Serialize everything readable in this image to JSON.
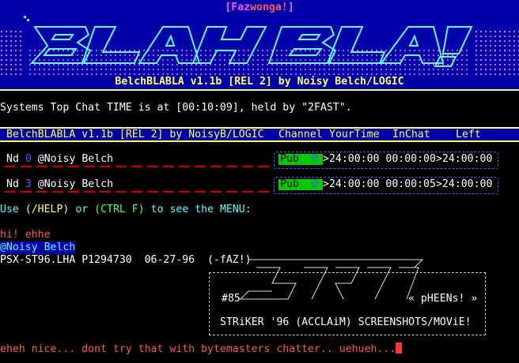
{
  "header": {
    "group_tag_prefix": "[Faz",
    "group_tag_accent": "wonga!",
    "group_tag_suffix": "]",
    "logo_text": "BLAH BLAH!",
    "subtitle": "BelchBLABLA v1.1b [REL 2] by Noisy Belch/LOGIC"
  },
  "top_chat_message": "Systems Top Chat TIME is at [00:10:09], held by \"2FAST\".",
  "status_bar": {
    "program": "BelchBLABLA v1.1b [REL 2] by NoisyB/LOGIC",
    "col_channel": "Channel",
    "col_yourtime": "YourTime",
    "col_inchat": "InChat",
    "col_left": "Left"
  },
  "nodes": [
    {
      "nd_label": "Nd",
      "node_num": "0",
      "name": "@Noisy Belch",
      "channel": "Pub",
      "chan_num": "0",
      "your_time": ">24:00:00",
      "in_chat": "00:00:00",
      "left": ">24:00:00"
    },
    {
      "nd_label": "Nd",
      "node_num": "3",
      "name": "@Noisy Belch",
      "channel": "Pub",
      "chan_num": "0",
      "your_time": ">24:00:00",
      "in_chat": "00:00:05",
      "left": ">24:00:00"
    }
  ],
  "help": {
    "use": "Use",
    "help_cmd": "(/HELP)",
    "or": "or",
    "ctrl_cmd": "(CTRL F)",
    "rest": "to see the MENU:"
  },
  "chat": {
    "line1": "hi! ehhe",
    "sender": "@Noisy Belch",
    "file_line": "PSX-ST96.LHA P1294730  06-27-96  (-fAZ!)"
  },
  "release_box": {
    "number": "#85",
    "tag": "« pHEENs! »",
    "title": "STRiKER '96 (ACCLAiM) SCREENSHOTS/MOViE!"
  },
  "input_line": "eheh nice... dont try that with bytemasters chatter.. uehueh...",
  "colors": {
    "banner_bg": "#0000aa",
    "accent_yellow": "#ffff55",
    "logo_cyan": "#55ffff",
    "dots_magenta": "#ff55ff",
    "pub_green": "#00cc00",
    "text_red": "#ff5555"
  }
}
